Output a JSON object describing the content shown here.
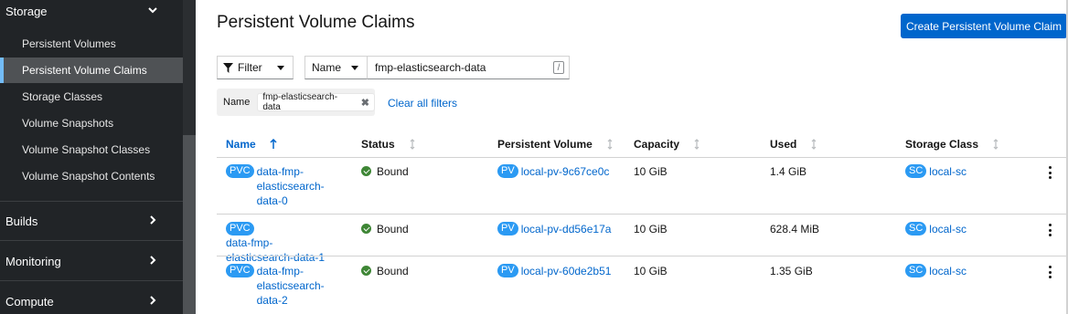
{
  "sidebar": {
    "storage_label": "Storage",
    "items": [
      {
        "label": "Persistent Volumes"
      },
      {
        "label": "Persistent Volume Claims"
      },
      {
        "label": "Storage Classes"
      },
      {
        "label": "Volume Snapshots"
      },
      {
        "label": "Volume Snapshot Classes"
      },
      {
        "label": "Volume Snapshot Contents"
      }
    ],
    "sections": [
      {
        "label": "Builds"
      },
      {
        "label": "Monitoring"
      },
      {
        "label": "Compute"
      }
    ]
  },
  "page": {
    "title": "Persistent Volume Claims",
    "create_label": "Create Persistent Volume Claim"
  },
  "filter": {
    "filter_label": "Filter",
    "name_label": "Name",
    "search_value": "fmp-elasticsearch-data",
    "slash_hint": "/",
    "chip_category": "Name",
    "chip_value": "fmp-elasticsearch-data",
    "clear_all": "Clear all filters"
  },
  "table": {
    "columns": [
      "Name",
      "Status",
      "Persistent Volume",
      "Capacity",
      "Used",
      "Storage Class"
    ],
    "rows": [
      {
        "badge": "PVC",
        "name": "data-fmp-elasticsearch-data-0",
        "name_lines": [
          "data-fmp-",
          "elasticsearch-",
          "data-0"
        ],
        "status": "Bound",
        "pv_badge": "PV",
        "pv": "local-pv-9c67ce0c",
        "capacity": "10 GiB",
        "used": "1.4 GiB",
        "sc_badge": "SC",
        "sc": "local-sc"
      },
      {
        "badge": "PVC",
        "name": "data-fmp-elasticsearch-data-1",
        "name_lines": [
          "data-fmp-",
          "elasticsearch-data-1"
        ],
        "status": "Bound",
        "pv_badge": "PV",
        "pv": "local-pv-dd56e17a",
        "capacity": "10 GiB",
        "used": "628.4 MiB",
        "sc_badge": "SC",
        "sc": "local-sc"
      },
      {
        "badge": "PVC",
        "name": "data-fmp-elasticsearch-data-2",
        "name_lines": [
          "data-fmp-",
          "elasticsearch-",
          "data-2"
        ],
        "status": "Bound",
        "pv_badge": "PV",
        "pv": "local-pv-60de2b51",
        "capacity": "10 GiB",
        "used": "1.35 GiB",
        "sc_badge": "SC",
        "sc": "local-sc"
      }
    ]
  },
  "colors": {
    "link": "#0066cc",
    "badge": "#2b9af3",
    "bound": "#3e8635",
    "sidebar_bg": "#212427"
  }
}
